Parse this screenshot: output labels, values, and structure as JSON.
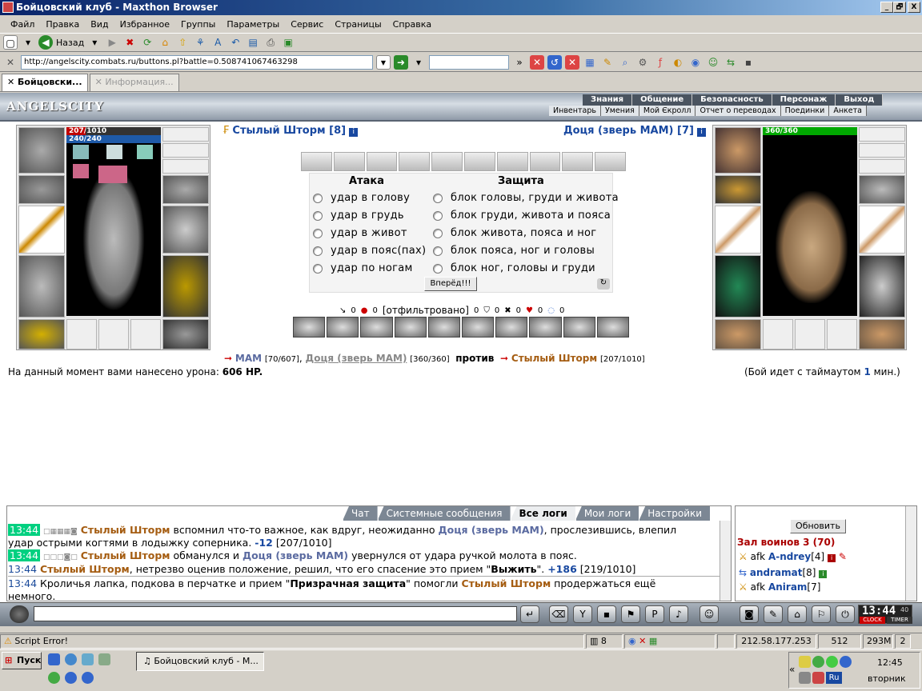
{
  "window": {
    "title": "Бойцовский клуб - Maxthon Browser",
    "btn_min": "_",
    "btn_max": "🗗",
    "btn_close": "X"
  },
  "menu": [
    "Файл",
    "Правка",
    "Вид",
    "Избранное",
    "Группы",
    "Параметры",
    "Сервис",
    "Страницы",
    "Справка"
  ],
  "toolbar": {
    "back_label": "Назад"
  },
  "address": {
    "url": "http://angelscity.combats.ru/buttons.pl?battle=0.508741067463298"
  },
  "tabs": [
    {
      "label": "Бойцовски..."
    },
    {
      "label": "Информация..."
    }
  ],
  "game": {
    "logo": "ANGELSCITY",
    "nav_top": [
      "Знания",
      "Общение",
      "Безопасность",
      "Персонаж",
      "Выход"
    ],
    "nav_sub": [
      "Инвентарь",
      "Умения",
      "Мой Єкролл",
      "Отчет о переводах",
      "Поединки",
      "Анкета"
    ],
    "player": {
      "name": "Стылый Шторм [8]",
      "hp": "207/1010",
      "mana": "240/240",
      "hp_fraction": 0.205
    },
    "enemy": {
      "name": "Доця (зверь МАМ) [7]",
      "hp": "360/360",
      "hp_fraction": 1.0
    },
    "attack_header": "Атака",
    "defense_header": "Защита",
    "attacks": [
      "удар в голову",
      "удар в грудь",
      "удар в живот",
      "удар в пояс(пах)",
      "удар по ногам"
    ],
    "blocks": [
      "блок головы, груди и живота",
      "блок груди, живота и пояса",
      "блок живота, пояса и ног",
      "блок пояса, ног и головы",
      "блок ног, головы и груди"
    ],
    "go_button": "Вперёд!!!",
    "filter_text": "[отфильтровано]",
    "counters": [
      "0",
      "0",
      "0",
      "0",
      "0",
      "0",
      "0"
    ],
    "versus": {
      "p1": "МАМ",
      "p1_hp": "[70/607]",
      "p2": "Доця (зверь МАМ)",
      "p2_hp": "[360/360]",
      "vs": "против",
      "p3": "Стылый Шторм",
      "p3_hp": "[207/1010]"
    },
    "damage_text": "На данный момент вами нанесено урона:",
    "damage_value": "606 HP.",
    "timeout_pre": "(Бой идет с таймаутом",
    "timeout_val": "1",
    "timeout_post": "мин.)"
  },
  "log_tabs": [
    "Чат",
    "Системные сообщения",
    "Все логи",
    "Мои логи",
    "Настройки"
  ],
  "log": {
    "l1_time": "13:44",
    "l1_name": "Стылый Шторм",
    "l1_text": "вспомнил что-то важное, как вдруг, неожиданно",
    "l1_name2": "Доця (зверь МАМ)",
    "l1_text2": ", прослезившись, влепил",
    "l2_text": "удар острыми когтями в лодыжку соперника.",
    "l2_dmg": "-12",
    "l2_hp": "[207/1010]",
    "l3_time": "13:44",
    "l3_name": "Стылый Шторм",
    "l3_text": "обманулся и",
    "l3_name2": "Доця (зверь МАМ)",
    "l3_text2": "увернулся от удара ручкой молота в пояс.",
    "l4_time": "13:44",
    "l4_name": "Стылый Шторм",
    "l4_text": ", нетрезво оценив положение, решил, что его спасение это прием \"",
    "l4_bold": "Выжить",
    "l4_text2": "\".",
    "l4_heal": "+186",
    "l4_hp": "[219/1010]",
    "l5_time": "13:44",
    "l5_text": "Кроличья лапка, подкова в перчатке и прием \"",
    "l5_bold": "Призрачная защита",
    "l5_text2": "\" помогли",
    "l5_name": "Стылый Шторм",
    "l5_text3": "продержаться ещё",
    "l6_text": "немного."
  },
  "side": {
    "refresh": "Обновить",
    "room": "Зал воинов 3 (70)",
    "users": [
      {
        "prefix": "afk",
        "name": "A-ndrey",
        "lvl": "[4]"
      },
      {
        "prefix": "",
        "name": "andramat",
        "lvl": "[8]"
      },
      {
        "prefix": "afk",
        "name": "Aniram",
        "lvl": "[7]"
      }
    ]
  },
  "clock": {
    "time": "13:44",
    "suffix": "40",
    "label1": "CLOCK",
    "label2": "TIMER"
  },
  "status": {
    "script_error": "Script Error!",
    "count": "8",
    "ip": "212.58.177.253",
    "bytes": "512 байт",
    "mem": "293M",
    "num": "2"
  },
  "taskbar": {
    "start": "Пуск",
    "app": "Бойцовский клуб - M...",
    "time": "12:45",
    "day": "вторник",
    "lang": "Ru"
  },
  "colors": {
    "titlebar": "#0a246a",
    "player_name": "#a55d12",
    "enemy_name": "#5a6aa0",
    "hp_bar": "#c00000",
    "mana_bar": "#1e5aa8",
    "enemy_hp_bar": "#00a800",
    "log_time_bg": "#00d080"
  }
}
